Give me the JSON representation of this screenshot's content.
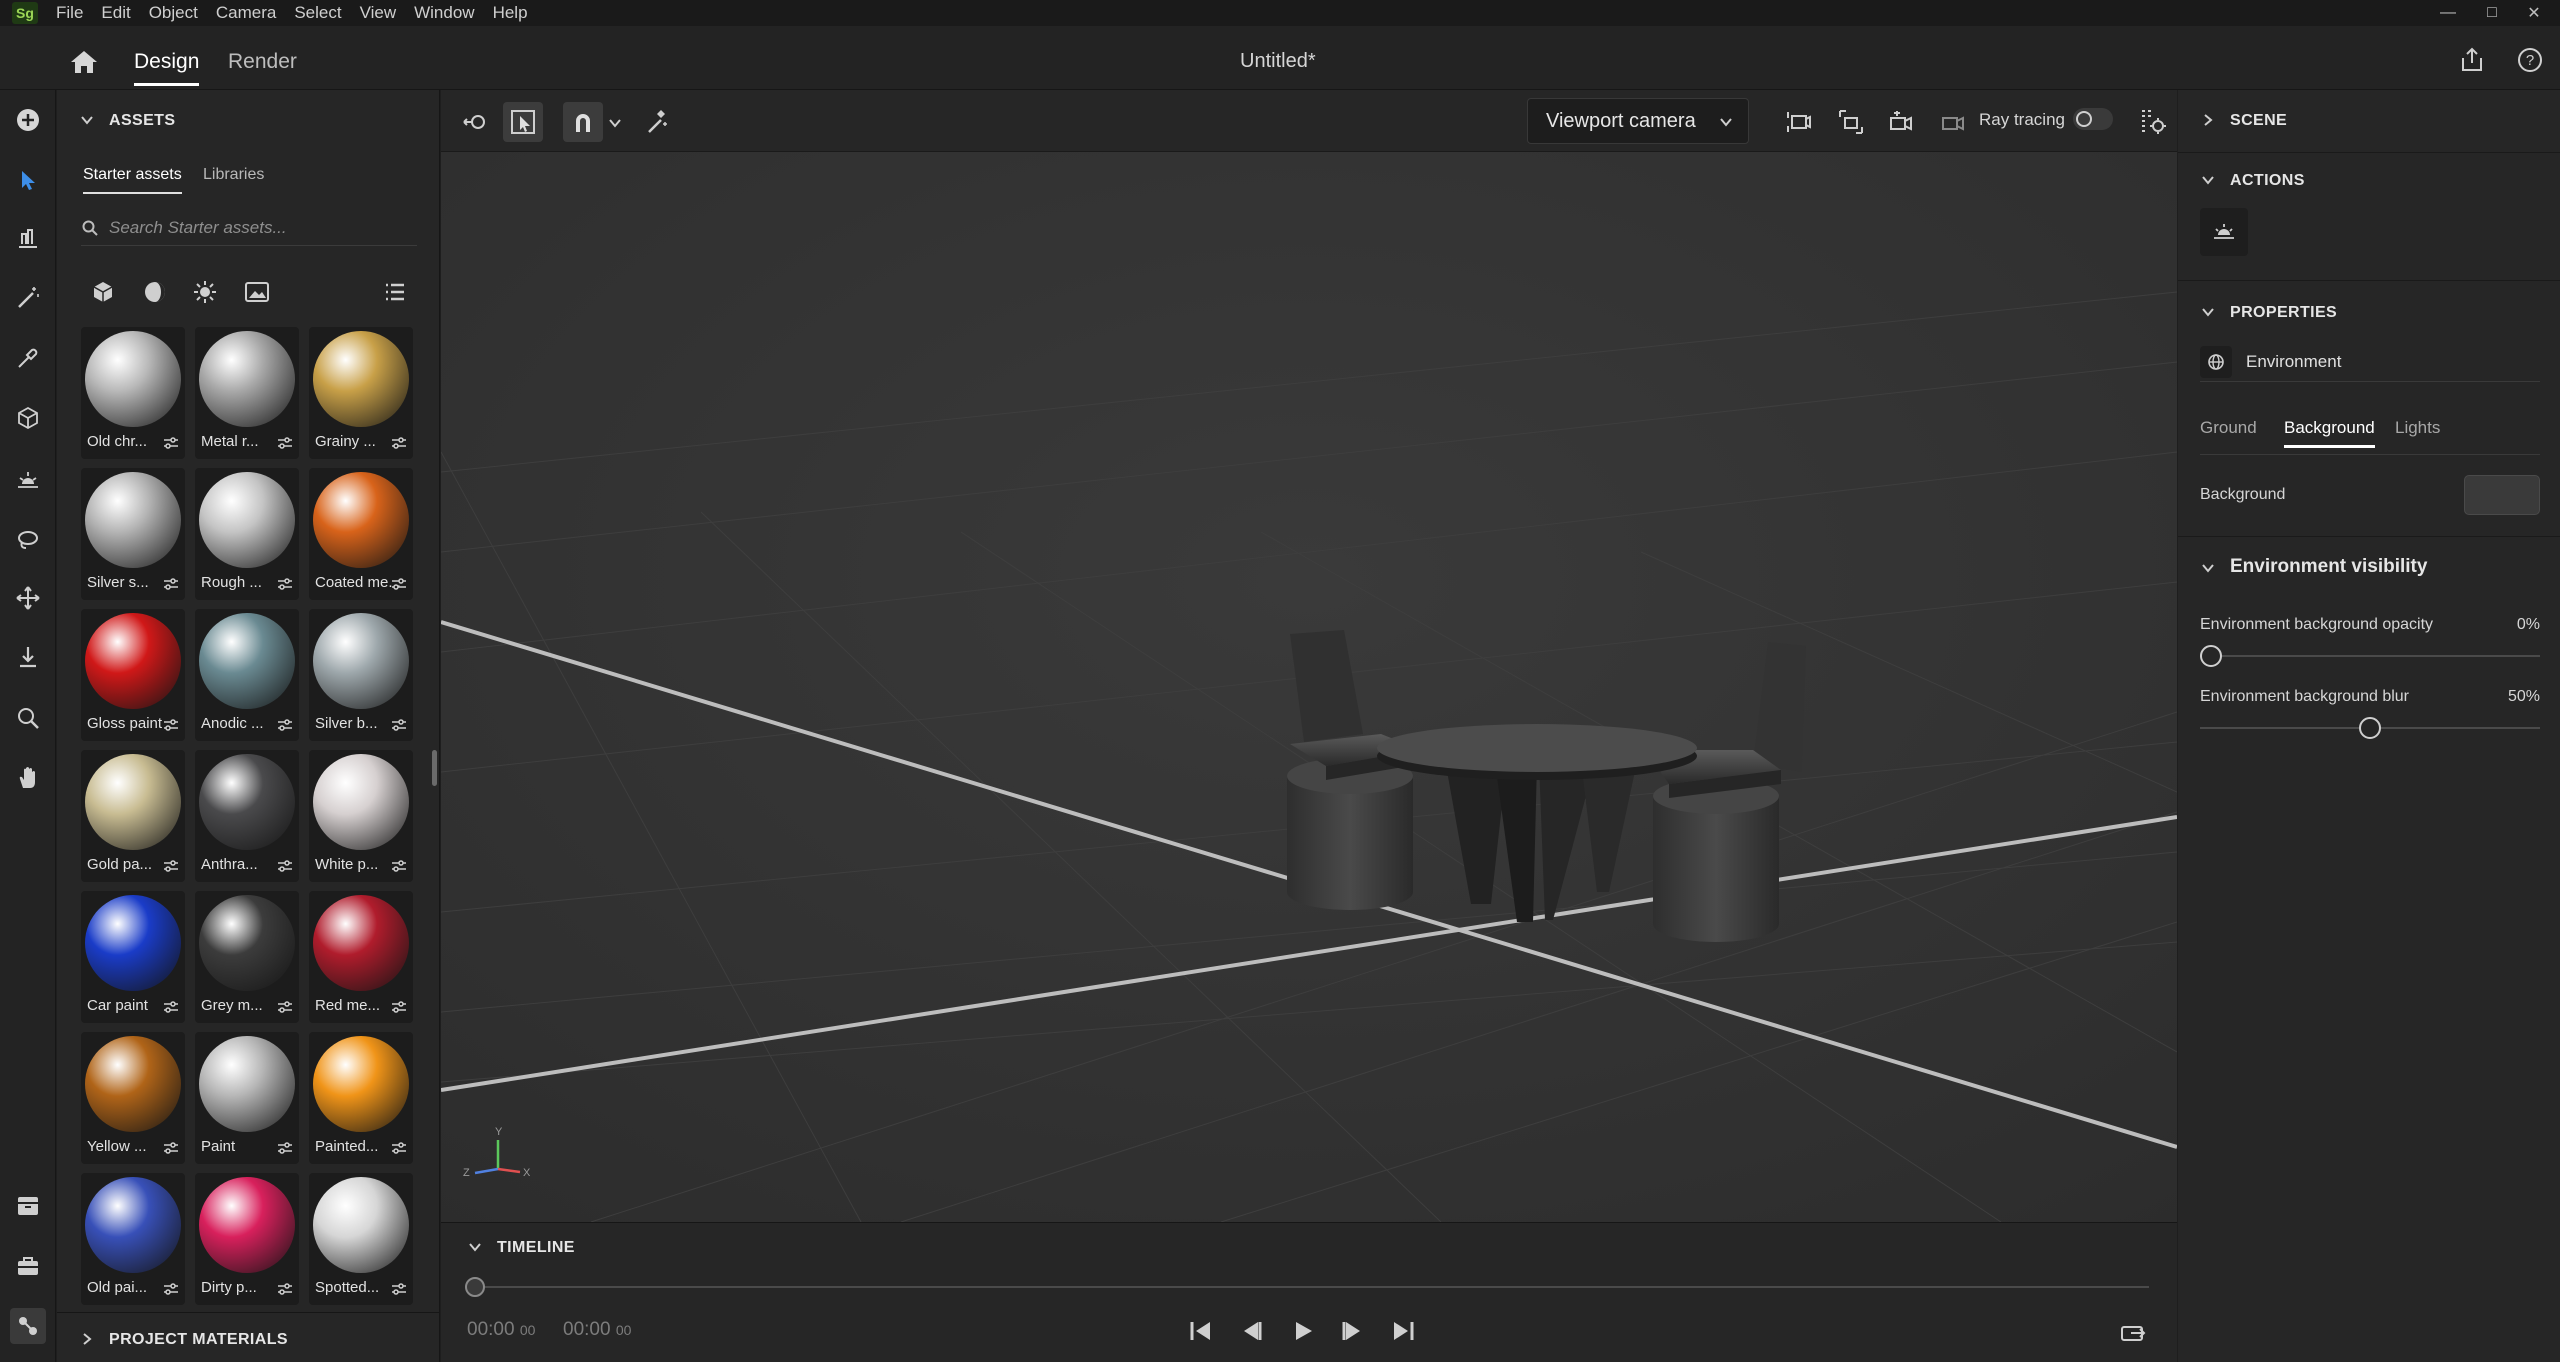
{
  "app": {
    "logo": "Sg",
    "menu": [
      "File",
      "Edit",
      "Object",
      "Camera",
      "Select",
      "View",
      "Window",
      "Help"
    ],
    "doc_title": "Untitled*"
  },
  "header": {
    "tabs": [
      {
        "label": "Design",
        "active": true
      },
      {
        "label": "Render",
        "active": false
      }
    ]
  },
  "left_toolbar": {
    "tools": [
      "add-icon",
      "select-arrow-icon",
      "stage-icon",
      "magic-wand-icon",
      "eyedropper-icon",
      "cube-icon",
      "sun-icon",
      "lasso-icon",
      "move-icon",
      "drop-to-ground-icon",
      "zoom-icon",
      "hand-icon",
      "archive-icon",
      "briefcase-icon",
      "graph-icon"
    ]
  },
  "assets": {
    "section_title": "ASSETS",
    "tabs": [
      {
        "label": "Starter assets",
        "active": true
      },
      {
        "label": "Libraries",
        "active": false
      }
    ],
    "search_placeholder": "Search Starter assets...",
    "filters": [
      "model-icon",
      "material-icon",
      "light-icon",
      "image-icon",
      "list-view-icon"
    ],
    "items": [
      {
        "label": "Old chr...",
        "color": "#b8b8b8"
      },
      {
        "label": "Metal r...",
        "color": "#a9a9a9"
      },
      {
        "label": "Grainy ...",
        "color": "#c8a048"
      },
      {
        "label": "Silver s...",
        "color": "#b4b4b4"
      },
      {
        "label": "Rough ...",
        "color": "#c4c4c4"
      },
      {
        "label": "Coated me...",
        "color": "#d8631a"
      },
      {
        "label": "Gloss paint",
        "color": "#d01818"
      },
      {
        "label": "Anodic ...",
        "color": "#6a8a92"
      },
      {
        "label": "Silver b...",
        "color": "#9ea8ac"
      },
      {
        "label": "Gold pa...",
        "color": "#c8bc92"
      },
      {
        "label": "Anthra...",
        "color": "#4a4a4c"
      },
      {
        "label": "White p...",
        "color": "#d6d0d0"
      },
      {
        "label": "Car paint",
        "color": "#1a3cc8"
      },
      {
        "label": "Grey m...",
        "color": "#3c3c3c"
      },
      {
        "label": "Red me...",
        "color": "#b01c2c"
      },
      {
        "label": "Yellow ...",
        "color": "#b06418"
      },
      {
        "label": "Paint",
        "color": "#b6b6b6"
      },
      {
        "label": "Painted...",
        "color": "#f09418"
      },
      {
        "label": "Old pai...",
        "color": "#3850b8"
      },
      {
        "label": "Dirty p...",
        "color": "#d8205c"
      },
      {
        "label": "Spotted...",
        "color": "#d6d6d6"
      }
    ],
    "project_materials": "PROJECT MATERIALS"
  },
  "viewport": {
    "camera": "Viewport camera",
    "ray_tracing_label": "Ray tracing",
    "ray_tracing_on": false,
    "axis_labels": {
      "y": "Y",
      "x": "X",
      "z": "Z"
    }
  },
  "timeline": {
    "title": "TIMELINE",
    "time_current": "00:00",
    "time_current_frames": "00",
    "time_total": "00:00",
    "time_total_frames": "00"
  },
  "right_panel": {
    "scene_title": "SCENE",
    "actions_title": "ACTIONS",
    "properties_title": "PROPERTIES",
    "environment_label": "Environment",
    "tabs": [
      {
        "label": "Ground",
        "active": false
      },
      {
        "label": "Background",
        "active": true
      },
      {
        "label": "Lights",
        "active": false
      }
    ],
    "background_label": "Background",
    "env_visibility_title": "Environment visibility",
    "opacity_label": "Environment background opacity",
    "opacity_value": "0%",
    "opacity_fraction": 0.0,
    "blur_label": "Environment background blur",
    "blur_value": "50%",
    "blur_fraction": 0.5
  }
}
